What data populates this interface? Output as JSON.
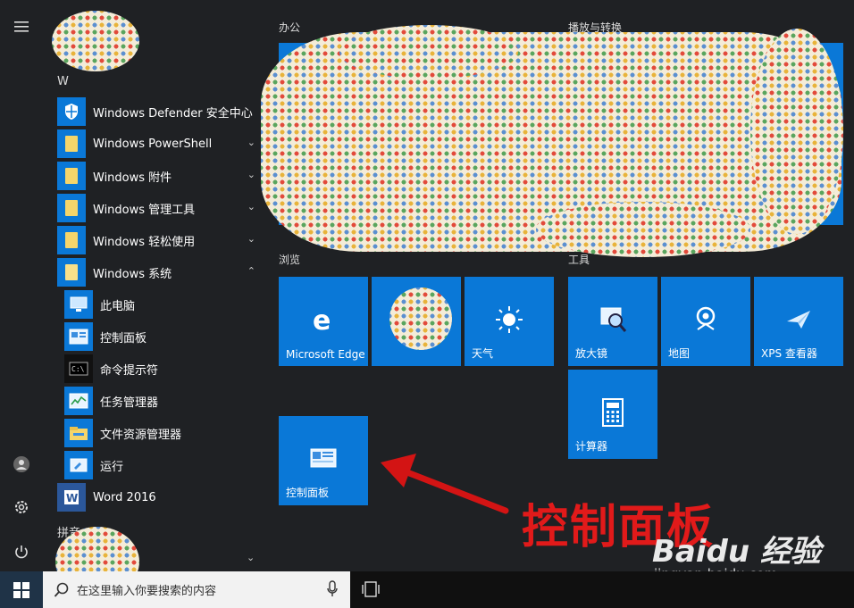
{
  "sections": {
    "w": "W",
    "pinyin": "拼音"
  },
  "apps": [
    {
      "label": "Windows Defender 安全中心",
      "chevron": ""
    },
    {
      "label": "Windows PowerShell",
      "chevron": "⌄"
    },
    {
      "label": "Windows 附件",
      "chevron": "⌄"
    },
    {
      "label": "Windows 管理工具",
      "chevron": "⌄"
    },
    {
      "label": "Windows 轻松使用",
      "chevron": "⌄"
    },
    {
      "label": "Windows 系统",
      "chevron": "⌃"
    }
  ],
  "system_items": [
    "此电脑",
    "控制面板",
    "命令提示符",
    "任务管理器",
    "文件资源管理器",
    "运行"
  ],
  "word": {
    "label": "Word 2016"
  },
  "groups": {
    "office": "办公",
    "media": "播放与转换",
    "browse": "浏览",
    "tools": "工具"
  },
  "tiles": {
    "edge": "Microsoft Edge",
    "weather": "天气",
    "magnifier": "放大镜",
    "maps": "地图",
    "xps": "XPS 查看器",
    "calculator": "计算器",
    "control_panel": "控制面板"
  },
  "taskbar": {
    "search_placeholder": "在这里输入你要搜索的内容"
  },
  "annotation": "控制面板",
  "watermark": {
    "brand": "Baidu 经验",
    "url": "jingyan.baidu.com"
  },
  "colors": {
    "tile": "#0a78d7",
    "accent_red": "#e11a1a",
    "background": "#1f2124"
  }
}
